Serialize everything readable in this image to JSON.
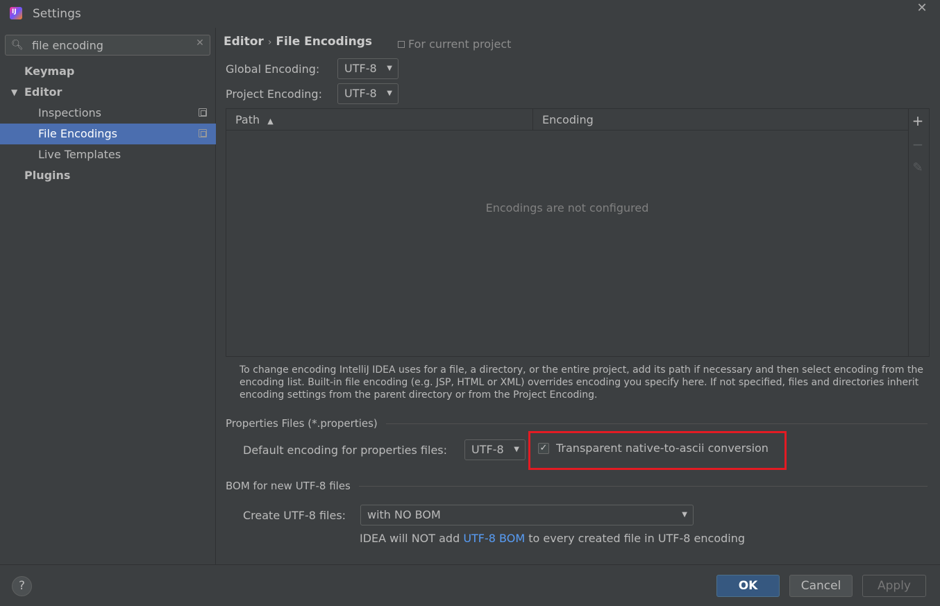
{
  "window": {
    "title": "Settings"
  },
  "search": {
    "value": "file encoding"
  },
  "sidebar": {
    "items": [
      {
        "label": "Keymap"
      },
      {
        "label": "Editor"
      },
      {
        "label": "Inspections"
      },
      {
        "label": "File Encodings"
      },
      {
        "label": "Live Templates"
      },
      {
        "label": "Plugins"
      }
    ]
  },
  "breadcrumb": {
    "parent": "Editor",
    "sep": "›",
    "current": "File Encodings"
  },
  "scope": {
    "label": "For current project"
  },
  "encodings": {
    "global_label": "Global Encoding:",
    "global_value": "UTF-8",
    "project_label": "Project Encoding:",
    "project_value": "UTF-8"
  },
  "table": {
    "columns": [
      "Path",
      "Encoding"
    ],
    "sort_indicator": "▲",
    "empty_text": "Encodings are not configured",
    "add": "+",
    "remove": "−",
    "edit": "✎"
  },
  "help_text": "To change encoding IntelliJ IDEA uses for a file, a directory, or the entire project, add its path if necessary and then select encoding from the encoding list. Built-in file encoding (e.g. JSP, HTML or XML) overrides encoding you specify here. If not specified, files and directories inherit encoding settings from the parent directory or from the Project Encoding.",
  "properties": {
    "section_title": "Properties Files (*.properties)",
    "default_label": "Default encoding for properties files:",
    "default_value": "UTF-8",
    "native_to_ascii_label": "Transparent native-to-ascii conversion",
    "native_to_ascii_checked": "✓"
  },
  "bom": {
    "section_title": "BOM for new UTF-8 files",
    "create_label": "Create UTF-8 files:",
    "create_value": "with NO BOM",
    "note_prefix": "IDEA will NOT add ",
    "note_link": "UTF-8 BOM",
    "note_suffix": " to every created file in UTF-8 encoding"
  },
  "footer": {
    "help": "?",
    "ok": "OK",
    "cancel": "Cancel",
    "apply": "Apply"
  },
  "colors": {
    "accent": "#4b6eaf",
    "ok_button": "#365880",
    "highlight": "#e31b23",
    "link": "#589df6"
  }
}
